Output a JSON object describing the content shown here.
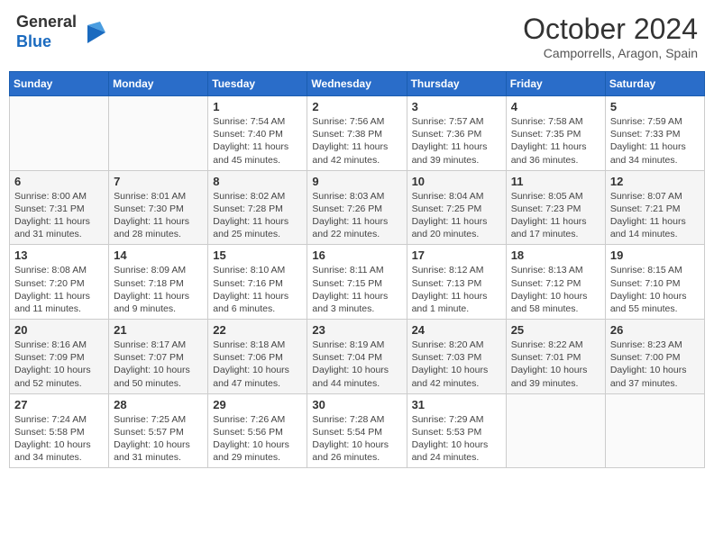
{
  "header": {
    "logo_line1": "General",
    "logo_line2": "Blue",
    "month": "October 2024",
    "location": "Camporrells, Aragon, Spain"
  },
  "weekdays": [
    "Sunday",
    "Monday",
    "Tuesday",
    "Wednesday",
    "Thursday",
    "Friday",
    "Saturday"
  ],
  "weeks": [
    [
      {
        "day": "",
        "sunrise": "",
        "sunset": "",
        "daylight": ""
      },
      {
        "day": "",
        "sunrise": "",
        "sunset": "",
        "daylight": ""
      },
      {
        "day": "1",
        "sunrise": "Sunrise: 7:54 AM",
        "sunset": "Sunset: 7:40 PM",
        "daylight": "Daylight: 11 hours and 45 minutes."
      },
      {
        "day": "2",
        "sunrise": "Sunrise: 7:56 AM",
        "sunset": "Sunset: 7:38 PM",
        "daylight": "Daylight: 11 hours and 42 minutes."
      },
      {
        "day": "3",
        "sunrise": "Sunrise: 7:57 AM",
        "sunset": "Sunset: 7:36 PM",
        "daylight": "Daylight: 11 hours and 39 minutes."
      },
      {
        "day": "4",
        "sunrise": "Sunrise: 7:58 AM",
        "sunset": "Sunset: 7:35 PM",
        "daylight": "Daylight: 11 hours and 36 minutes."
      },
      {
        "day": "5",
        "sunrise": "Sunrise: 7:59 AM",
        "sunset": "Sunset: 7:33 PM",
        "daylight": "Daylight: 11 hours and 34 minutes."
      }
    ],
    [
      {
        "day": "6",
        "sunrise": "Sunrise: 8:00 AM",
        "sunset": "Sunset: 7:31 PM",
        "daylight": "Daylight: 11 hours and 31 minutes."
      },
      {
        "day": "7",
        "sunrise": "Sunrise: 8:01 AM",
        "sunset": "Sunset: 7:30 PM",
        "daylight": "Daylight: 11 hours and 28 minutes."
      },
      {
        "day": "8",
        "sunrise": "Sunrise: 8:02 AM",
        "sunset": "Sunset: 7:28 PM",
        "daylight": "Daylight: 11 hours and 25 minutes."
      },
      {
        "day": "9",
        "sunrise": "Sunrise: 8:03 AM",
        "sunset": "Sunset: 7:26 PM",
        "daylight": "Daylight: 11 hours and 22 minutes."
      },
      {
        "day": "10",
        "sunrise": "Sunrise: 8:04 AM",
        "sunset": "Sunset: 7:25 PM",
        "daylight": "Daylight: 11 hours and 20 minutes."
      },
      {
        "day": "11",
        "sunrise": "Sunrise: 8:05 AM",
        "sunset": "Sunset: 7:23 PM",
        "daylight": "Daylight: 11 hours and 17 minutes."
      },
      {
        "day": "12",
        "sunrise": "Sunrise: 8:07 AM",
        "sunset": "Sunset: 7:21 PM",
        "daylight": "Daylight: 11 hours and 14 minutes."
      }
    ],
    [
      {
        "day": "13",
        "sunrise": "Sunrise: 8:08 AM",
        "sunset": "Sunset: 7:20 PM",
        "daylight": "Daylight: 11 hours and 11 minutes."
      },
      {
        "day": "14",
        "sunrise": "Sunrise: 8:09 AM",
        "sunset": "Sunset: 7:18 PM",
        "daylight": "Daylight: 11 hours and 9 minutes."
      },
      {
        "day": "15",
        "sunrise": "Sunrise: 8:10 AM",
        "sunset": "Sunset: 7:16 PM",
        "daylight": "Daylight: 11 hours and 6 minutes."
      },
      {
        "day": "16",
        "sunrise": "Sunrise: 8:11 AM",
        "sunset": "Sunset: 7:15 PM",
        "daylight": "Daylight: 11 hours and 3 minutes."
      },
      {
        "day": "17",
        "sunrise": "Sunrise: 8:12 AM",
        "sunset": "Sunset: 7:13 PM",
        "daylight": "Daylight: 11 hours and 1 minute."
      },
      {
        "day": "18",
        "sunrise": "Sunrise: 8:13 AM",
        "sunset": "Sunset: 7:12 PM",
        "daylight": "Daylight: 10 hours and 58 minutes."
      },
      {
        "day": "19",
        "sunrise": "Sunrise: 8:15 AM",
        "sunset": "Sunset: 7:10 PM",
        "daylight": "Daylight: 10 hours and 55 minutes."
      }
    ],
    [
      {
        "day": "20",
        "sunrise": "Sunrise: 8:16 AM",
        "sunset": "Sunset: 7:09 PM",
        "daylight": "Daylight: 10 hours and 52 minutes."
      },
      {
        "day": "21",
        "sunrise": "Sunrise: 8:17 AM",
        "sunset": "Sunset: 7:07 PM",
        "daylight": "Daylight: 10 hours and 50 minutes."
      },
      {
        "day": "22",
        "sunrise": "Sunrise: 8:18 AM",
        "sunset": "Sunset: 7:06 PM",
        "daylight": "Daylight: 10 hours and 47 minutes."
      },
      {
        "day": "23",
        "sunrise": "Sunrise: 8:19 AM",
        "sunset": "Sunset: 7:04 PM",
        "daylight": "Daylight: 10 hours and 44 minutes."
      },
      {
        "day": "24",
        "sunrise": "Sunrise: 8:20 AM",
        "sunset": "Sunset: 7:03 PM",
        "daylight": "Daylight: 10 hours and 42 minutes."
      },
      {
        "day": "25",
        "sunrise": "Sunrise: 8:22 AM",
        "sunset": "Sunset: 7:01 PM",
        "daylight": "Daylight: 10 hours and 39 minutes."
      },
      {
        "day": "26",
        "sunrise": "Sunrise: 8:23 AM",
        "sunset": "Sunset: 7:00 PM",
        "daylight": "Daylight: 10 hours and 37 minutes."
      }
    ],
    [
      {
        "day": "27",
        "sunrise": "Sunrise: 7:24 AM",
        "sunset": "Sunset: 5:58 PM",
        "daylight": "Daylight: 10 hours and 34 minutes."
      },
      {
        "day": "28",
        "sunrise": "Sunrise: 7:25 AM",
        "sunset": "Sunset: 5:57 PM",
        "daylight": "Daylight: 10 hours and 31 minutes."
      },
      {
        "day": "29",
        "sunrise": "Sunrise: 7:26 AM",
        "sunset": "Sunset: 5:56 PM",
        "daylight": "Daylight: 10 hours and 29 minutes."
      },
      {
        "day": "30",
        "sunrise": "Sunrise: 7:28 AM",
        "sunset": "Sunset: 5:54 PM",
        "daylight": "Daylight: 10 hours and 26 minutes."
      },
      {
        "day": "31",
        "sunrise": "Sunrise: 7:29 AM",
        "sunset": "Sunset: 5:53 PM",
        "daylight": "Daylight: 10 hours and 24 minutes."
      },
      {
        "day": "",
        "sunrise": "",
        "sunset": "",
        "daylight": ""
      },
      {
        "day": "",
        "sunrise": "",
        "sunset": "",
        "daylight": ""
      }
    ]
  ]
}
